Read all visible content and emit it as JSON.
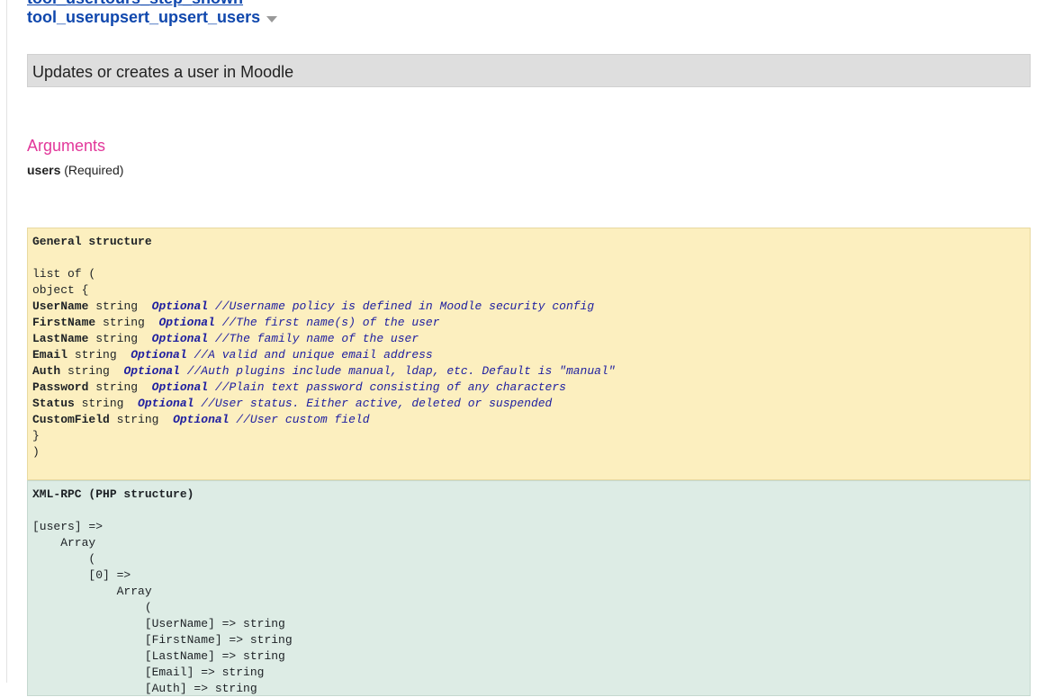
{
  "previous_function": "tool_usertours_step_shown",
  "function": {
    "name": "tool_userupsert_upsert_users",
    "description": "Updates or creates a user in Moodle"
  },
  "arguments": {
    "heading": "Arguments",
    "arg_name": "users",
    "arg_required": "(Required)"
  },
  "general_structure": {
    "title": "General structure",
    "open_list": "list of (",
    "open_object": "object {",
    "fields": [
      {
        "name": "UserName",
        "type": "string",
        "optional": "Optional",
        "comment": "//Username policy is defined in Moodle security config"
      },
      {
        "name": "FirstName",
        "type": "string",
        "optional": "Optional",
        "comment": "//The first name(s) of the user"
      },
      {
        "name": "LastName",
        "type": "string",
        "optional": "Optional",
        "comment": "//The family name of the user"
      },
      {
        "name": "Email",
        "type": "string",
        "optional": "Optional",
        "comment": "//A valid and unique email address"
      },
      {
        "name": "Auth",
        "type": "string",
        "optional": "Optional",
        "comment": "//Auth plugins include manual, ldap, etc. Default is \"manual\""
      },
      {
        "name": "Password",
        "type": "string",
        "optional": "Optional",
        "comment": "//Plain text password consisting of any characters"
      },
      {
        "name": "Status",
        "type": "string",
        "optional": "Optional",
        "comment": "//User status. Either active, deleted or suspended"
      },
      {
        "name": "CustomField",
        "type": "string",
        "optional": "Optional",
        "comment": "//User custom field"
      }
    ],
    "close_object": "}",
    "close_list": ")"
  },
  "xmlrpc": {
    "title": "XML-RPC (PHP structure)",
    "lines": [
      "[users] =>",
      "    Array",
      "        (",
      "        [0] =>",
      "            Array",
      "                (",
      "                [UserName] => string",
      "                [FirstName] => string",
      "                [LastName] => string",
      "                [Email] => string",
      "                [Auth] => string"
    ]
  },
  "colors": {
    "link": "#0f47ad",
    "heading_accent": "#e2379a",
    "general_bg": "#fcefbf",
    "xmlrpc_bg": "#ddece5",
    "description_bg": "#dedede"
  }
}
